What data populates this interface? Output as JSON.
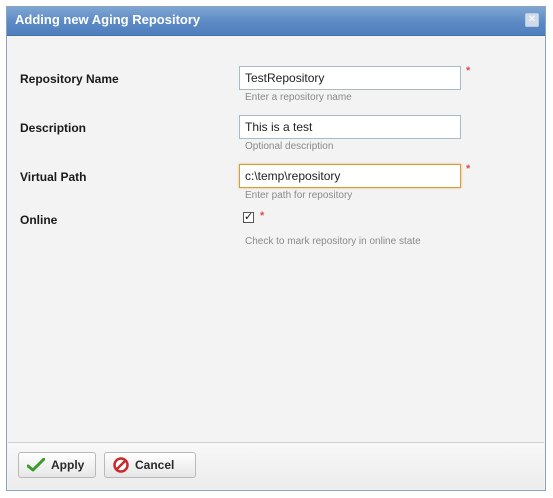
{
  "dialog": {
    "title": "Adding new Aging Repository",
    "close_glyph": "✕"
  },
  "fields": {
    "repository_name": {
      "label": "Repository Name",
      "value": "TestRepository",
      "hint": "Enter a repository name",
      "required": true
    },
    "description": {
      "label": "Description",
      "value": "This is a test",
      "hint": "Optional description",
      "required": false
    },
    "virtual_path": {
      "label": "Virtual Path",
      "value": "c:\\temp\\repository",
      "hint": "Enter path for repository",
      "required": true
    },
    "online": {
      "label": "Online",
      "checked": true,
      "hint": "Check to mark repository in online state",
      "required": true
    }
  },
  "required_marker": "*",
  "buttons": {
    "apply": "Apply",
    "cancel": "Cancel"
  },
  "colors": {
    "title_bar": "#5b89c4",
    "required_marker": "#d65050",
    "apply_icon": "#3b9c2a",
    "cancel_icon": "#c72c2c"
  },
  "icons": {
    "apply": "checkmark-icon",
    "cancel": "no-entry-icon",
    "required": "asterisk-icon",
    "close": "close-icon"
  }
}
